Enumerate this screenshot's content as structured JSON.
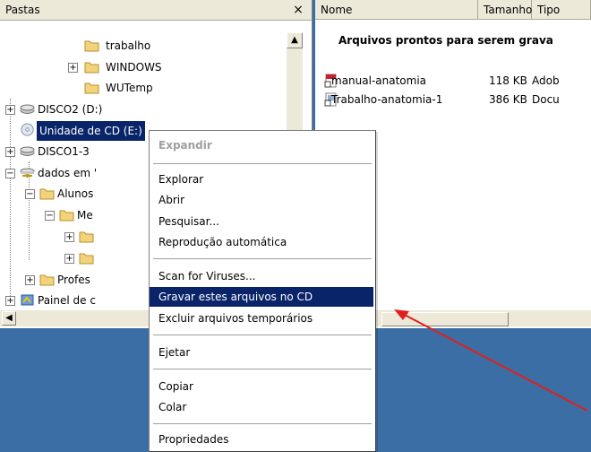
{
  "folders_pane": {
    "title": "Pastas",
    "close_glyph": "×",
    "tree": [
      {
        "label": "trabalho"
      },
      {
        "label": "WINDOWS"
      },
      {
        "label": "WUTemp"
      },
      {
        "label": "DISCO2 (D:)"
      },
      {
        "label": "Unidade de CD (E:)"
      },
      {
        "label": "DISCO1-3"
      },
      {
        "label": "dados em '"
      },
      {
        "label": "Alunos"
      },
      {
        "label": "Me"
      },
      {
        "label": ""
      },
      {
        "label": ""
      },
      {
        "label": "Profes"
      },
      {
        "label": "Painel de c"
      }
    ]
  },
  "files_pane": {
    "columns": [
      "Nome",
      "Tamanho",
      "Tipo"
    ],
    "group_header": "Arquivos prontos para serem grava",
    "files": [
      {
        "name": "manual-anatomia",
        "size": "118 KB",
        "type": "Adob"
      },
      {
        "name": "Trabalho-anatomia-1",
        "size": "386 KB",
        "type": "Docu"
      }
    ]
  },
  "context_menu": {
    "items": {
      "expandir": "Expandir",
      "explorar": "Explorar",
      "abrir": "Abrir",
      "pesquisar": "Pesquisar...",
      "reproducao": "Reprodução automática",
      "scan": "Scan for Viruses...",
      "gravar": "Gravar estes arquivos no CD",
      "excluir": "Excluir arquivos temporários",
      "ejetar": "Ejetar",
      "copiar": "Copiar",
      "colar": "Colar",
      "propriedades": "Propriedades"
    }
  },
  "colors": {
    "selection": "#0a246a",
    "desktop": "#3a6ea5",
    "chrome": "#ece9d8",
    "arrow": "#e0201c"
  },
  "icons": [
    "folder-icon",
    "drive-icon",
    "cd-drive-icon",
    "network-drive-icon",
    "control-panel-icon",
    "pdf-file-icon",
    "word-file-icon"
  ]
}
